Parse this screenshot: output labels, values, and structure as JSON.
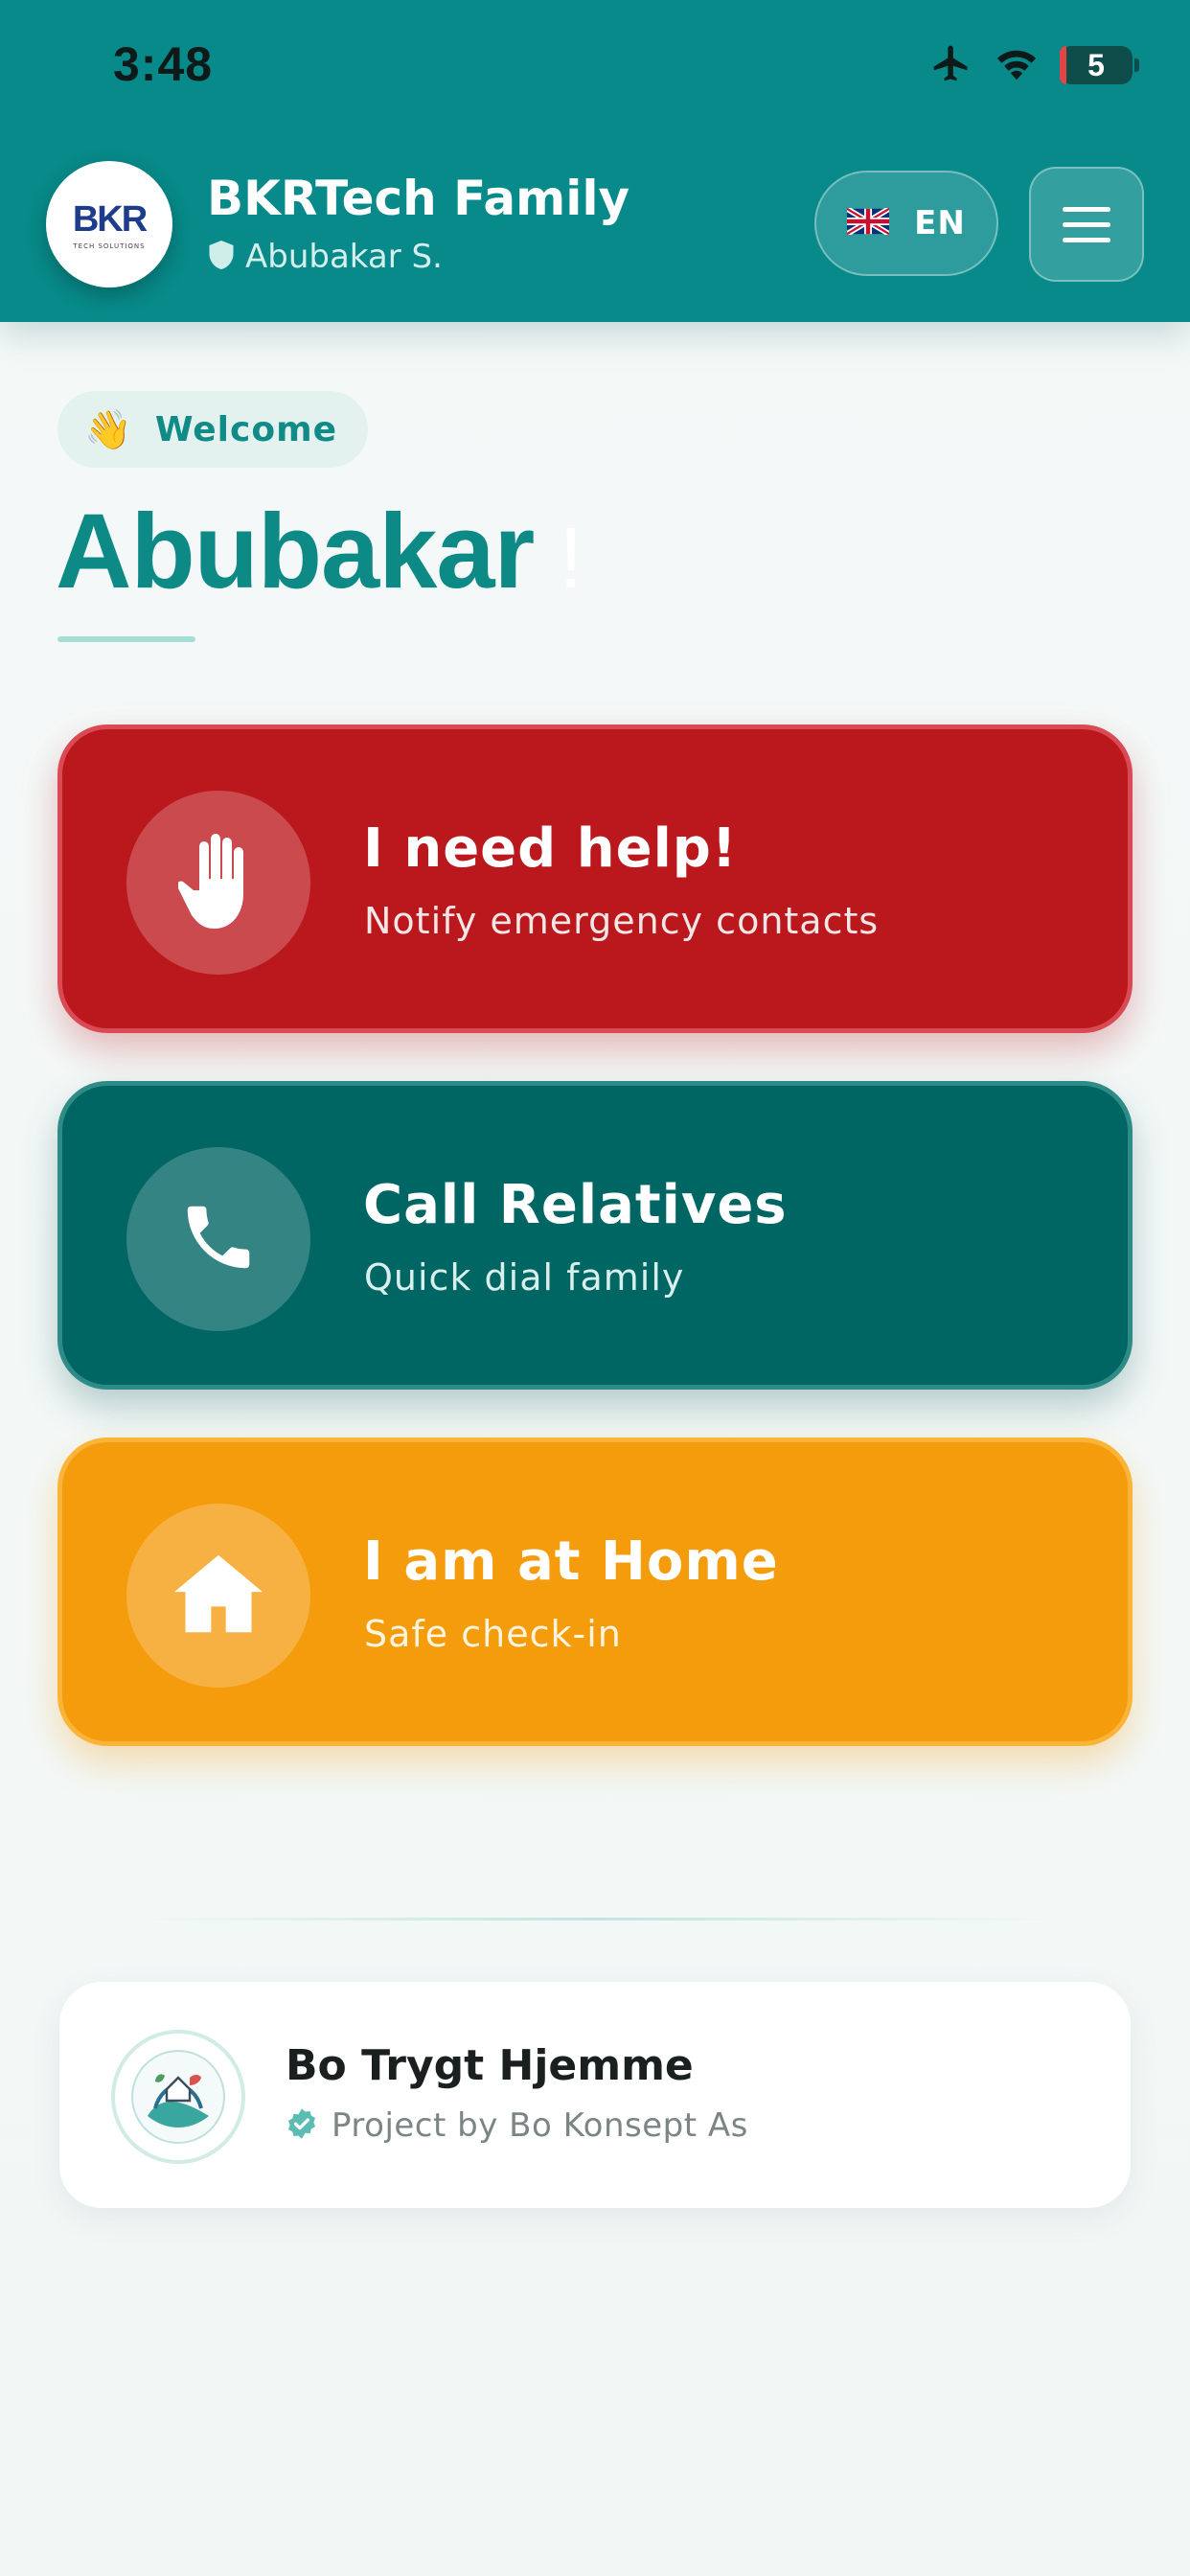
{
  "status_bar": {
    "time": "3:48",
    "battery": "5",
    "icons": [
      "airplane-icon",
      "wifi-icon",
      "battery-icon"
    ]
  },
  "header": {
    "logo_text": "BKR",
    "logo_subtext": "TECH SOLUTIONS",
    "app_title": "BKRTech Family",
    "user_name": "Abubakar S.",
    "language": "EN",
    "background_color": "#078a89"
  },
  "welcome": {
    "chip_emoji": "👋",
    "chip_label": "Welcome",
    "name": "Abubakar",
    "name_suffix": "!"
  },
  "actions": [
    {
      "title": "I need help!",
      "subtitle": "Notify emergency contacts",
      "icon": "hand-icon",
      "color": "#bb181d"
    },
    {
      "title": "Call Relatives",
      "subtitle": "Quick dial family",
      "icon": "phone-icon",
      "color": "#006664"
    },
    {
      "title": "I am at Home",
      "subtitle": "Safe check-in",
      "icon": "home-icon",
      "color": "#f59c0d"
    }
  ],
  "footer": {
    "title": "Bo Trygt Hjemme",
    "subtitle": "Project by Bo Konsept As"
  }
}
